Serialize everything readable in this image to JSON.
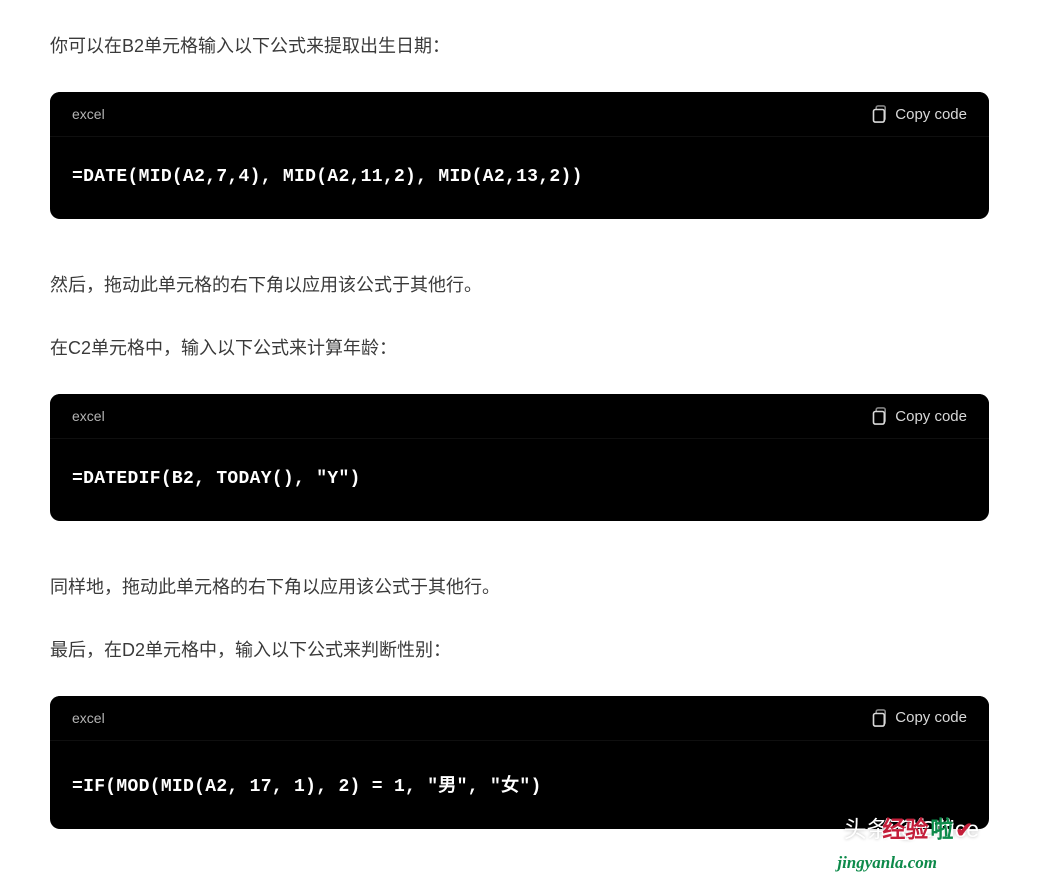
{
  "paragraphs": {
    "p1": "你可以在B2单元格输入以下公式来提取出生日期：",
    "p2": "然后，拖动此单元格的右下角以应用该公式于其他行。",
    "p3": "在C2单元格中，输入以下公式来计算年龄：",
    "p4": "同样地，拖动此单元格的右下角以应用该公式于其他行。",
    "p5": "最后，在D2单元格中，输入以下公式来判断性别："
  },
  "codeblocks": [
    {
      "lang": "excel",
      "copy_label": "Copy code",
      "code": "=DATE(MID(A2,7,4), MID(A2,11,2), MID(A2,13,2))"
    },
    {
      "lang": "excel",
      "copy_label": "Copy code",
      "code": "=DATEDIF(B2, TODAY(), \"Y\")"
    },
    {
      "lang": "excel",
      "copy_label": "Copy code",
      "code": "=IF(MOD(MID(A2, 17, 1), 2) = 1, \"男\", \"女\")"
    }
  ],
  "watermark": {
    "credit": "头条 @Office",
    "overlay_red": "经验",
    "overlay_green": "啦",
    "site": "jingyanla.com"
  }
}
